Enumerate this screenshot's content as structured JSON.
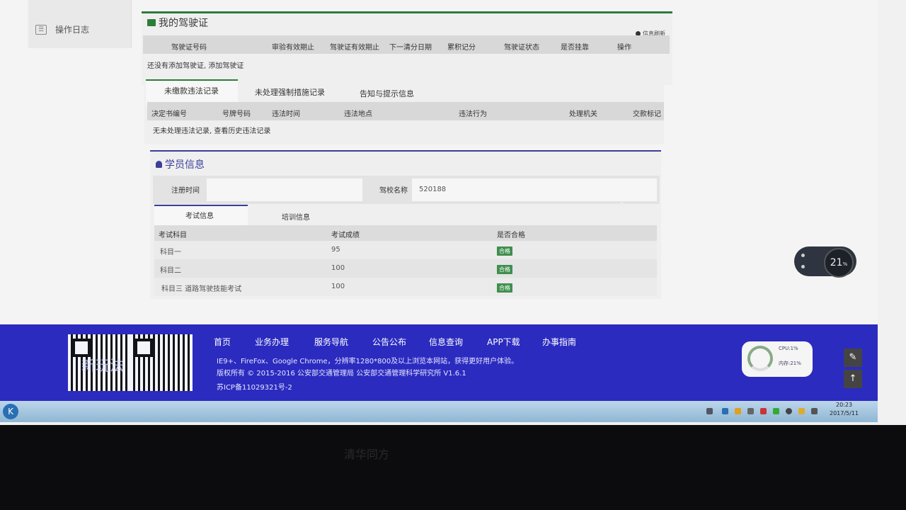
{
  "sidebar": {
    "item_label": "操作日志"
  },
  "license": {
    "title": "我的驾驶证",
    "refresh": "信息刷新",
    "columns": [
      "驾驶证号码",
      "审验有效期止",
      "驾驶证有效期止",
      "下一清分日期",
      "累积记分",
      "驾驶证状态",
      "是否挂靠",
      "操作"
    ],
    "empty_text": "还没有添加驾驶证, 添加驾驶证"
  },
  "violations": {
    "tabs": [
      "未缴款违法记录",
      "未处理强制措施记录",
      "告知与提示信息"
    ],
    "columns": [
      "决定书编号",
      "号牌号码",
      "违法时间",
      "违法地点",
      "违法行为",
      "处理机关",
      "交款标记"
    ],
    "empty_text": "无未处理违法记录, 查看历史违法记录"
  },
  "student": {
    "title": "学员信息",
    "reg_label": "注册时间",
    "reg_value": "",
    "school_label": "驾校名称",
    "school_value": "520188",
    "tabs": [
      "考试信息",
      "培训信息"
    ],
    "columns": [
      "考试科目",
      "考试成绩",
      "是否合格"
    ],
    "rows": [
      {
        "subject": "科目一",
        "score": "95",
        "pass": "合格"
      },
      {
        "subject": "科目二",
        "score": "100",
        "pass": "合格"
      },
      {
        "subject": "科目三 道路驾驶技能考试",
        "score": "100",
        "pass": "合格"
      }
    ]
  },
  "footer": {
    "nav": [
      "首页",
      "业务办理",
      "服务导航",
      "公告公布",
      "信息查询",
      "APP下载",
      "办事指南"
    ],
    "browser_text": "IE9+、FireFox、Google Chrome，分辨率1280*800及以上浏览本网站，获得更好用户体验。",
    "copyright": "版权所有 © 2015-2016 公安部交通管理局 公安部交通管理科学研究所 V1.6.1",
    "icp": "苏ICP备11029321号-2",
    "overlay": "新玩法"
  },
  "taskbar": {
    "time": "20:23",
    "date": "2017/5/11"
  },
  "widget": {
    "percent": "21",
    "unit": "%"
  },
  "gauge": {
    "cpu": "CPU:1%",
    "mem": "内存:21%"
  },
  "monitor": {
    "brand": "清华同方"
  }
}
